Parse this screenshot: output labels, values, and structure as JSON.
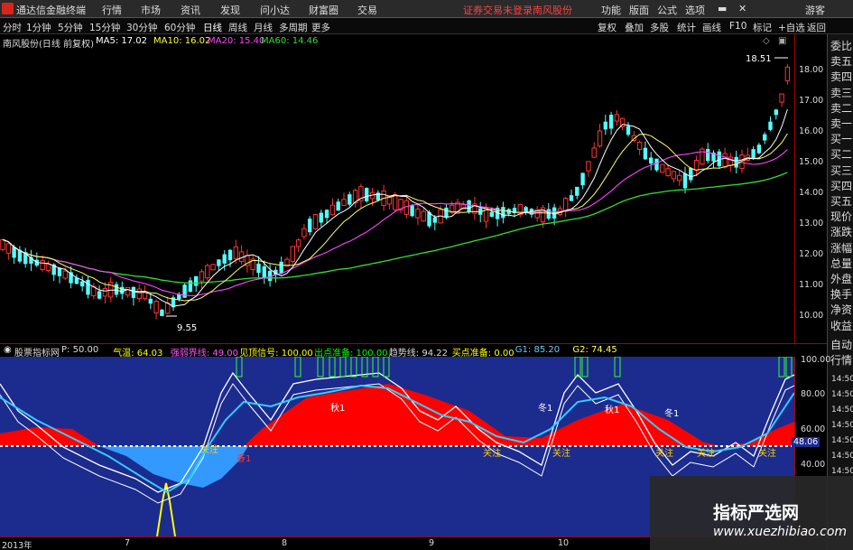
{
  "topbar": {
    "app_title": "通达信金融终端",
    "menus": [
      "行情",
      "市场",
      "资讯",
      "发现",
      "问小达",
      "财富圈",
      "交易"
    ],
    "login_status": "证券交易未登录",
    "stock_name": "南风股份",
    "right_menus": [
      "功能",
      "版面",
      "公式",
      "选项"
    ],
    "guest": "游客"
  },
  "periods": [
    "分时",
    "1分钟",
    "5分钟",
    "15分钟",
    "30分钟",
    "60分钟",
    "日线",
    "周线",
    "月线",
    "多周期",
    "更多"
  ],
  "tools": [
    "复权",
    "叠加",
    "多股",
    "统计",
    "画线",
    "F10",
    "标记",
    "+自选",
    "返回"
  ],
  "info": {
    "title": "南风股份(日线 前复权)",
    "ma5": "MA5: 17.02",
    "ma10": "MA10: 16.02",
    "ma20": "MA20: 15.40",
    "ma60": "MA60: 14.46"
  },
  "side_tabs": [
    "委比",
    "卖五",
    "卖四",
    "卖三",
    "卖二",
    "卖一",
    "买一",
    "买二",
    "买三",
    "买四",
    "买五",
    "现价",
    "涨跌",
    "涨幅",
    "总量",
    "外盘",
    "换手",
    "净资",
    "收益",
    "自动",
    "行情"
  ],
  "price_axis": [
    "18.00",
    "17.00",
    "16.00",
    "15.00",
    "14.00",
    "13.00",
    "12.00",
    "11.00",
    "10.00"
  ],
  "annotations": {
    "high": "18.51",
    "low": "9.55"
  },
  "indicator": {
    "name": "股票指标网",
    "values": [
      {
        "text": "P: 50.00",
        "color": "#dddddd"
      },
      {
        "text": "气温: 64.03",
        "color": "#ffff00"
      },
      {
        "text": "强弱界线: 49.00",
        "color": "#ff55ff"
      },
      {
        "text": "见顶信号: 100.00",
        "color": "#ffff00"
      },
      {
        "text": "出点准备: 100.00",
        "color": "#00ff00"
      },
      {
        "text": "趋势线: 94.22",
        "color": "#dddddd"
      },
      {
        "text": "买点准备: 0.00",
        "color": "#ffff00"
      },
      {
        "text": "G1: 85.20",
        "color": "#66ccff"
      },
      {
        "text": "G2: 74.45",
        "color": "#ffff66"
      }
    ],
    "axis": [
      "100.00",
      "80.00",
      "60.00",
      "40.00"
    ],
    "current": "48.06",
    "time_labels": [
      "14:50",
      "14:50",
      "14:50",
      "14:50",
      "14:50",
      "14:50",
      "14:50"
    ],
    "seasons": [
      "秋1",
      "冬1",
      "秋1",
      "冬1"
    ],
    "spring": [
      "春1"
    ],
    "buy_labels": [
      "关注",
      "关注",
      "关注",
      "关注",
      "关注",
      "关注"
    ]
  },
  "dates": [
    "2013年",
    "7",
    "8",
    "9",
    "10"
  ],
  "watermark": {
    "name": "指标严选网",
    "url": "www.xuezhibiao.com"
  },
  "colors": {
    "up": "#ff3333",
    "down": "#54ffff",
    "ma5": "#ffffff",
    "ma10": "#ffff33",
    "ma20": "#ff44ff",
    "ma60": "#33dd33",
    "panel_bg": "#1c2b8e",
    "red_area": "#ff0000",
    "blue_area": "#3399ff"
  }
}
